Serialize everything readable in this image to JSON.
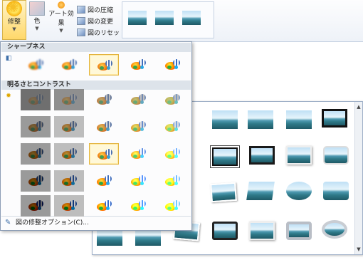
{
  "ribbon": {
    "corrections_label": "修整",
    "color_label": "色",
    "artistic_label": "アート効果",
    "compress_label": "図の圧縮",
    "change_label": "図の変更",
    "reset_label": "図のリセット"
  },
  "dropdown": {
    "sharpness_header": "シャープネス",
    "brightness_header": "明るさとコントラスト",
    "footer_link": "図の修整オプション(C)...",
    "sharpness_selected_index": 2,
    "brightness_selected_cell": [
      2,
      2
    ]
  },
  "icons": {
    "corrections": "sun-icon",
    "color": "color-swatch-icon",
    "artistic": "artistic-effects-icon",
    "compress": "compress-picture-icon",
    "change": "change-picture-icon",
    "reset": "reset-picture-icon",
    "sharpness": "sharpen-icon",
    "brightness": "brightness-icon",
    "options": "picture-options-icon"
  },
  "colors": {
    "accent_selected": "#e3b43e",
    "section_header": "#dde3ea",
    "ribbon_active": "#ffd86a"
  }
}
